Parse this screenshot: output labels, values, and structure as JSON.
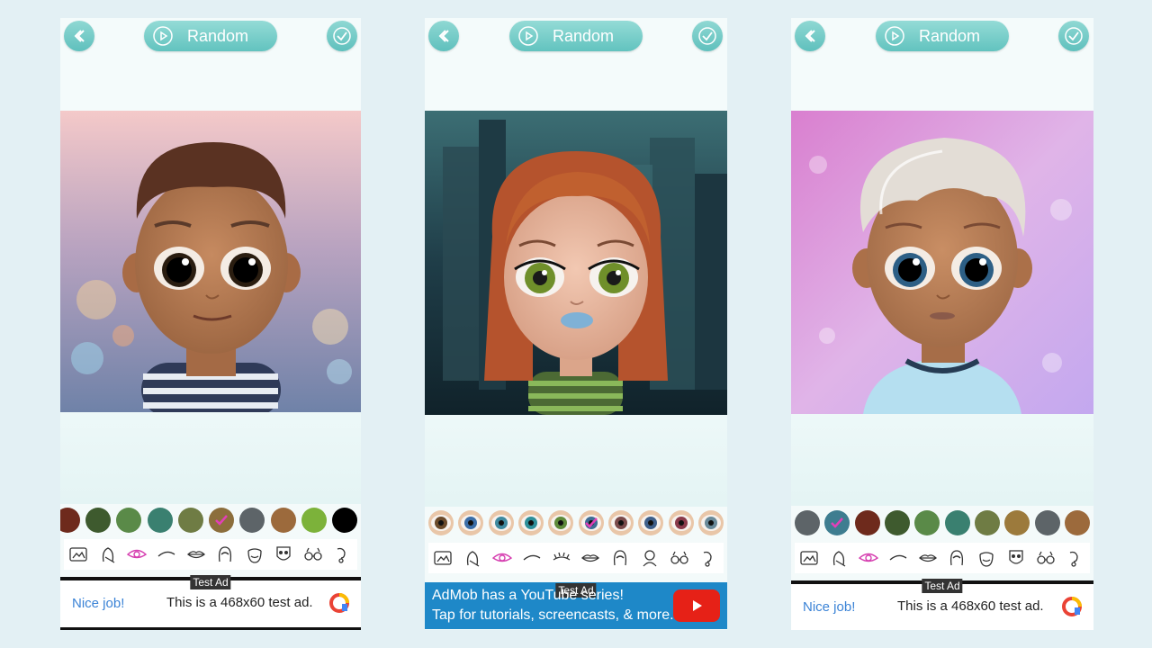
{
  "screens": [
    {
      "random_label": "Random",
      "colors": [
        "#6e2a1c",
        "#3e5a2e",
        "#5a8a48",
        "#3a8070",
        "#6f7c44",
        "#8c6e3c",
        "#5d6468",
        "#9c6a3c",
        "#7cb23a",
        "#000000"
      ],
      "selected_color_index": 5,
      "ad": {
        "badge": "Test Ad",
        "headline": "Nice job!",
        "text": "This is a 468x60 test ad."
      }
    },
    {
      "random_label": "Random",
      "eye_colors": [
        "#6b4a2a",
        "#3b6ea8",
        "#3f8aa0",
        "#2e8f9a",
        "#5e8a3a",
        "#3e6c94",
        "#7a4a4a",
        "#3e5f8a",
        "#8a3a4a",
        "#6a8a9a"
      ],
      "selected_eye_index": 5,
      "ad": {
        "badge": "Test Ad",
        "line1": "AdMob has a YouTube series!",
        "line2": "Tap for tutorials, screencasts, & more."
      }
    },
    {
      "random_label": "Random",
      "colors": [
        "#5d6468",
        "#3e7d90",
        "#6e2a1c",
        "#3e5a2e",
        "#5a8a48",
        "#3a8070",
        "#6f7c44",
        "#9c7a3c",
        "#5d6468",
        "#9c6a3c"
      ],
      "selected_color_index": 1,
      "ad": {
        "badge": "Test Ad",
        "headline": "Nice job!",
        "text": "This is a 468x60 test ad."
      }
    }
  ],
  "tool_icons": [
    "background-icon",
    "face-icon",
    "eye-icon",
    "eyebrow-icon",
    "lips-icon",
    "hair-icon",
    "beard-icon",
    "mask-icon",
    "glasses-icon",
    "earring-icon"
  ],
  "tool_icons_middle": [
    "background-icon",
    "face-icon",
    "eye-icon",
    "eyebrow-icon",
    "eyelash-icon",
    "lips-icon",
    "hair-icon",
    "head-icon",
    "glasses-icon",
    "earring-icon"
  ]
}
